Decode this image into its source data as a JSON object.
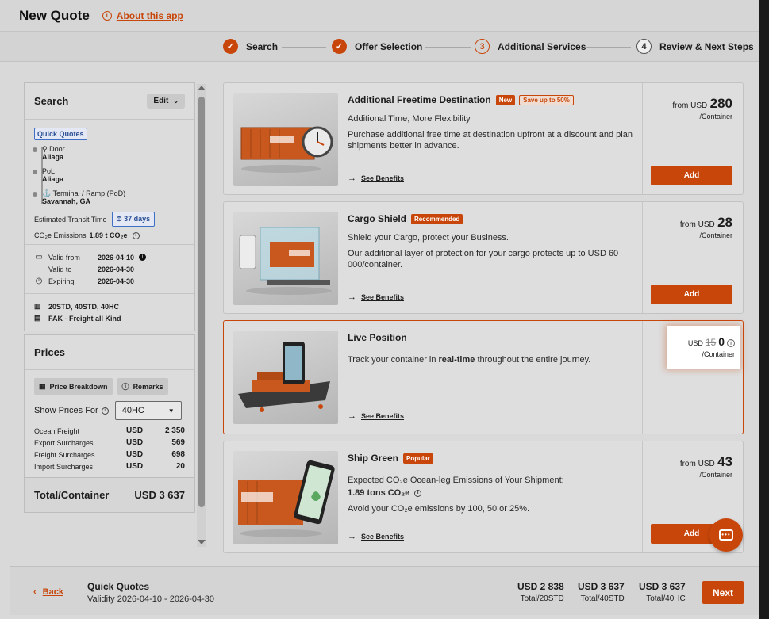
{
  "header": {
    "title": "New Quote",
    "about_label": "About this app"
  },
  "stepper": [
    {
      "label": "Search",
      "state": "done",
      "mark": "✓"
    },
    {
      "label": "Offer Selection",
      "state": "done",
      "mark": "✓"
    },
    {
      "label": "Additional Services",
      "state": "active",
      "mark": "3"
    },
    {
      "label": "Review & Next Steps",
      "state": "todo",
      "mark": "4"
    }
  ],
  "search": {
    "title": "Search",
    "edit_label": "Edit",
    "badge": "Quick Quotes",
    "stops": [
      {
        "type": "Door",
        "place": "Aliaga"
      },
      {
        "type": "PoL",
        "place": "Aliaga"
      },
      {
        "type": "Terminal / Ramp (PoD)",
        "place": "Savannah, GA"
      }
    ],
    "transit_label": "Estimated Transit Time",
    "transit_value": "37 days",
    "emissions_label": "CO₂e Emissions",
    "emissions_value": "1.89 t CO₂e",
    "valid_from_label": "Valid from",
    "valid_from": "2026-04-10",
    "valid_to_label": "Valid to",
    "valid_to": "2026-04-30",
    "expiring_label": "Expiring",
    "expiring": "2026-04-30",
    "containers": "20STD, 40STD, 40HC",
    "commodity": "FAK - Freight all Kind"
  },
  "prices": {
    "title": "Prices",
    "breakdown_label": "Price Breakdown",
    "remarks_label": "Remarks",
    "show_for_label": "Show Prices For",
    "show_for_value": "40HC",
    "charges": [
      {
        "name": "Ocean Freight",
        "currency": "USD",
        "amount": "2 350"
      },
      {
        "name": "Export Surcharges",
        "currency": "USD",
        "amount": "569"
      },
      {
        "name": "Freight Surcharges",
        "currency": "USD",
        "amount": "698"
      },
      {
        "name": "Import Surcharges",
        "currency": "USD",
        "amount": "20"
      }
    ],
    "total_label": "Total/Container",
    "total_value": "USD 3 637"
  },
  "services": [
    {
      "title": "Additional Freetime Destination",
      "badge": "New",
      "badge2": "Save up to 50%",
      "desc1": "Additional Time, More Flexibility",
      "desc2": "Purchase additional free time at destination upfront at a discount and plan shipments better in advance.",
      "benefits": "See Benefits",
      "price_from": "from USD",
      "price": "280",
      "per": "/Container",
      "add": "Add"
    },
    {
      "title": "Cargo Shield",
      "badge": "Recommended",
      "desc1": "Shield your Cargo, protect your Business.",
      "desc2": "Our additional layer of protection for your cargo protects up to USD 60 000/container.",
      "benefits": "See Benefits",
      "price_from": "from USD",
      "price": "28",
      "per": "/Container",
      "add": "Add"
    },
    {
      "title": "Live Position",
      "desc_pre": "Track your container in ",
      "desc_bold": "real-time",
      "desc_post": " throughout the entire journey.",
      "benefits": "See Benefits",
      "currency": "USD",
      "old_price": "15",
      "price": "0",
      "per": "/Container"
    },
    {
      "title": "Ship Green",
      "badge": "Popular",
      "desc1": "Expected CO₂e Ocean-leg Emissions of Your Shipment:",
      "desc1b": "1.89 tons CO₂e",
      "desc2": "Avoid your CO₂e emissions by 100, 50 or 25%.",
      "benefits": "See Benefits",
      "price_from": "from USD",
      "price": "43",
      "per": "/Container",
      "add": "Add"
    }
  ],
  "footer": {
    "back_label": "Back",
    "quote_title": "Quick Quotes",
    "validity": "Validity 2026-04-10 - 2026-04-30",
    "totals": [
      {
        "value": "USD 2 838",
        "label": "Total/20STD"
      },
      {
        "value": "USD 3 637",
        "label": "Total/40STD"
      },
      {
        "value": "USD 3 637",
        "label": "Total/40HC"
      }
    ],
    "next_label": "Next"
  },
  "colors": {
    "accent": "#c8460a",
    "info_blue": "#3d6fc4"
  }
}
